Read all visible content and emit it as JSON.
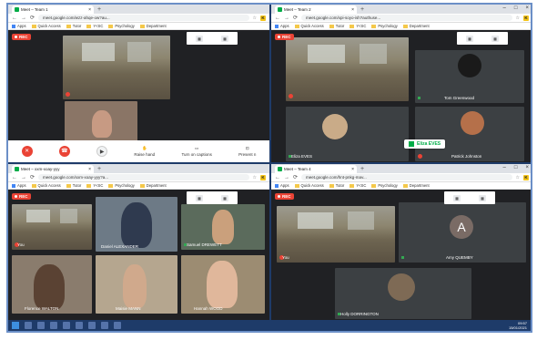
{
  "windows": [
    {
      "tab_title": "Meet – Team 1",
      "url": "meet.google.com/wzz-ahqe-ow?au...",
      "bookmarks": [
        "Apps",
        "Quick Access",
        "Tutor",
        "Y<SC",
        "Psychology",
        "Department"
      ],
      "participants": [
        {
          "name": "",
          "muted": true
        },
        {
          "name": "",
          "muted": false
        }
      ],
      "controls": [
        "Raise hand",
        "Turn on captions",
        "Present n"
      ]
    },
    {
      "tab_title": "Meet – Team 2",
      "url": "meet.google.com/xpi-soyo-ish?authuse...",
      "bookmarks": [
        "Apps",
        "Quick Access",
        "Tutor",
        "Y<SC",
        "Psychology",
        "Department"
      ],
      "participants": [
        {
          "name": "",
          "muted": true
        },
        {
          "name": "Tom Greenwood",
          "muted": false
        },
        {
          "name": "Eliza EVES",
          "muted": false
        },
        {
          "name": "Patrick Johnston",
          "muted": true
        }
      ],
      "popup": {
        "name": "Eliza EVES",
        "sub": "ElI Ev"
      }
    },
    {
      "tab_title": "Meet – xxm-xoay-yyy",
      "url": "meet.google.com/xxm-xoay-yyy?a...",
      "bookmarks": [
        "Apps",
        "Quick Access",
        "Tutor",
        "Y<SC",
        "Psychology",
        "Department"
      ],
      "participants": [
        {
          "name": "You",
          "muted": true
        },
        {
          "name": "Daniel ALEXANDER",
          "muted": false
        },
        {
          "name": "Samuel DREWETT",
          "muted": false
        },
        {
          "name": "Florence WALTON",
          "muted": false
        },
        {
          "name": "Maisie MANN",
          "muted": false
        },
        {
          "name": "Hannah WOOD",
          "muted": false
        }
      ]
    },
    {
      "tab_title": "Meet – Team 4",
      "url": "meet.google.com/hnt-pnkg-mav...",
      "bookmarks": [
        "Apps",
        "Quick Access",
        "Tutor",
        "Y<SC",
        "Psychology",
        "Department"
      ],
      "participants": [
        {
          "name": "You",
          "muted": true
        },
        {
          "name": "Amy QUEMBY",
          "muted": false,
          "initial": "A"
        },
        {
          "name": "Holly DORRINGTON",
          "muted": false
        }
      ]
    }
  ],
  "rec_label": "REC",
  "clock": {
    "time": "09:57",
    "date": "15/01/2021"
  },
  "colors": {
    "meet_green": "#00ac47",
    "rec_red": "#ea4335",
    "taskbar": "#1e3b69",
    "frame": "#6b8fc7"
  }
}
